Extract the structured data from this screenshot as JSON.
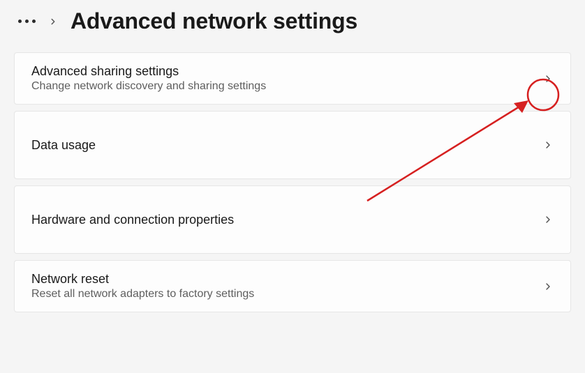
{
  "header": {
    "title": "Advanced network settings"
  },
  "items": [
    {
      "title": "Advanced sharing settings",
      "subtitle": "Change network discovery and sharing settings"
    },
    {
      "title": "Data usage",
      "subtitle": ""
    },
    {
      "title": "Hardware and connection properties",
      "subtitle": ""
    },
    {
      "title": "Network reset",
      "subtitle": "Reset all network adapters to factory settings"
    }
  ]
}
